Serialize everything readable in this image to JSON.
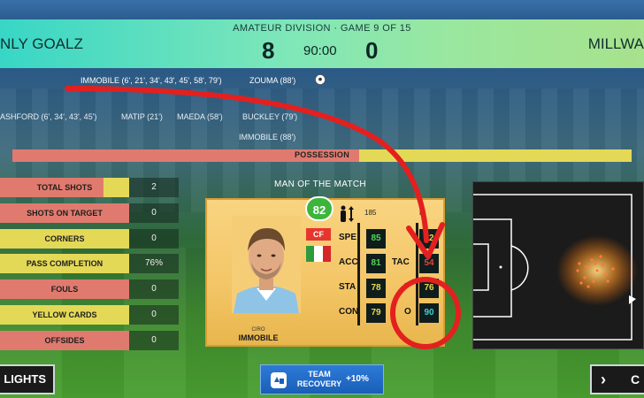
{
  "match": {
    "division": "AMATEUR DIVISION · GAME 9 OF 15",
    "home_team": "NLY GOALZ",
    "away_team": "MILLWA",
    "home_score": "8",
    "away_score": "0",
    "clock": "90:00"
  },
  "scorers": {
    "home_line1": "IMMOBILE (6', 21', 34', 43', 45', 58', 79')",
    "home_line1b": "ZOUMA (88')",
    "away_row": [
      "ASHFORD (6', 34', 43', 45')",
      "MATIP (21')",
      "MAEDA (58')",
      "BUCKLEY (79')"
    ],
    "away_row2": "IMMOBILE (88')"
  },
  "possession": {
    "label": "POSSESSION",
    "home_fraction": 0.56
  },
  "stats": [
    {
      "label": "TOTAL SHOTS",
      "value": "2",
      "home_fraction": 0.8
    },
    {
      "label": "SHOTS ON TARGET",
      "value": "0",
      "home_fraction": 1.0
    },
    {
      "label": "CORNERS",
      "value": "0",
      "home_fraction": 0.0
    },
    {
      "label": "PASS COMPLETION",
      "value": "76%",
      "home_fraction": 0.0
    },
    {
      "label": "FOULS",
      "value": "0",
      "home_fraction": 1.0
    },
    {
      "label": "YELLOW CARDS",
      "value": "0",
      "home_fraction": 0.0
    },
    {
      "label": "OFFSIDES",
      "value": "0",
      "home_fraction": 1.0
    }
  ],
  "motm": {
    "title": "MAN OF THE MATCH",
    "rating": "82",
    "height": "185",
    "position": "CF",
    "first_name": "CIRO",
    "last_name": "IMMOBILE",
    "flag_colors": [
      "#2f9a3c",
      "#ffffff",
      "#d5262a"
    ],
    "foot": "R",
    "attrs_left": [
      {
        "label": "SPE",
        "value": "85",
        "color": "#4fd84f"
      },
      {
        "label": "ACC",
        "value": "81",
        "color": "#4fd84f"
      },
      {
        "label": "STA",
        "value": "78",
        "color": "#e6d84a"
      },
      {
        "label": "CON",
        "value": "79",
        "color": "#e6d84a"
      }
    ],
    "attrs_right": [
      {
        "label": "",
        "value": "72",
        "color": "#e6d84a"
      },
      {
        "label": "TAC",
        "value": "54",
        "color": "#e6403a"
      },
      {
        "label": "P",
        "value": "76",
        "color": "#e6d84a"
      },
      {
        "label": "O",
        "value": "90",
        "color": "#3fd0d0"
      }
    ]
  },
  "buttons": {
    "highlights": "LIGHTS",
    "recovery_line1": "TEAM",
    "recovery_line2": "RECOVERY",
    "recovery_pct": "+10%",
    "continue": "C"
  },
  "colors": {
    "home": "#e07a6f",
    "away": "#e4d957",
    "annotation_red": "#e3201f"
  },
  "icons": {
    "ball": "soccer-ball-icon",
    "height": "height-arrows-icon",
    "recovery": "recovery-icon",
    "continue": "chevron-right-icon"
  }
}
